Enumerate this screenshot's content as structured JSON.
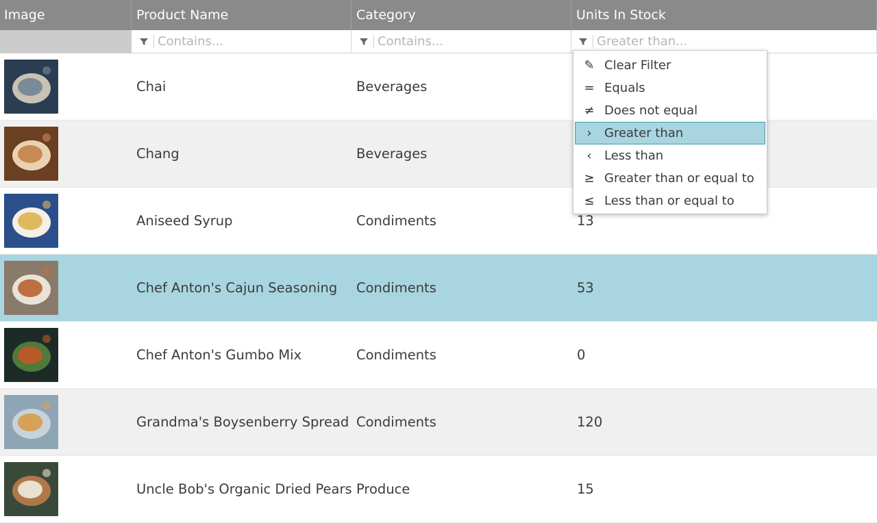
{
  "columns": {
    "image": "Image",
    "product_name": "Product Name",
    "category": "Category",
    "units_in_stock": "Units In Stock"
  },
  "filters": {
    "product_name_placeholder": "Contains...",
    "category_placeholder": "Contains...",
    "units_placeholder": "Greater than..."
  },
  "rows": [
    {
      "name": "Chai",
      "category": "Beverages",
      "units": "",
      "thumb_colors": [
        "#2b3d52",
        "#7a8a96",
        "#c9c2b3"
      ]
    },
    {
      "name": "Chang",
      "category": "Beverages",
      "units": "",
      "thumb_colors": [
        "#6b3f22",
        "#c88a55",
        "#e9d2b0"
      ]
    },
    {
      "name": "Aniseed Syrup",
      "category": "Condiments",
      "units": "13",
      "thumb_colors": [
        "#2a4f8a",
        "#e0b860",
        "#f4f0e6"
      ]
    },
    {
      "name": "Chef Anton's Cajun Seasoning",
      "category": "Condiments",
      "units": "53",
      "thumb_colors": [
        "#8a7a6a",
        "#c07040",
        "#e8e2d8"
      ]
    },
    {
      "name": "Chef Anton's Gumbo Mix",
      "category": "Condiments",
      "units": "0",
      "thumb_colors": [
        "#1d2b28",
        "#b85a2a",
        "#4e7a3a"
      ]
    },
    {
      "name": "Grandma's Boysenberry Spread",
      "category": "Condiments",
      "units": "120",
      "thumb_colors": [
        "#8ea5b5",
        "#d6a257",
        "#c8d2d8"
      ]
    },
    {
      "name": "Uncle Bob's Organic Dried Pears",
      "category": "Produce",
      "units": "15",
      "thumb_colors": [
        "#3a4a3a",
        "#e8e0d0",
        "#b07848"
      ]
    }
  ],
  "selected_row_index": 3,
  "filter_menu": {
    "items": [
      {
        "label": "Clear Filter",
        "icon": "eraser-icon",
        "glyph": "✎"
      },
      {
        "label": "Equals",
        "icon": "equals-icon",
        "glyph": "="
      },
      {
        "label": "Does not equal",
        "icon": "not-equal-icon",
        "glyph": "≠"
      },
      {
        "label": "Greater than",
        "icon": "greater-than-icon",
        "glyph": "›"
      },
      {
        "label": "Less than",
        "icon": "less-than-icon",
        "glyph": "‹"
      },
      {
        "label": "Greater than or equal to",
        "icon": "greater-equal-icon",
        "glyph": "≥"
      },
      {
        "label": "Less than or equal to",
        "icon": "less-equal-icon",
        "glyph": "≤"
      }
    ],
    "active_index": 3
  },
  "colors": {
    "header_bg": "#8a8a8a",
    "selection": "#a8d5e0",
    "selection_border": "#3d9ab5",
    "alt_row": "#f0f0f0"
  }
}
